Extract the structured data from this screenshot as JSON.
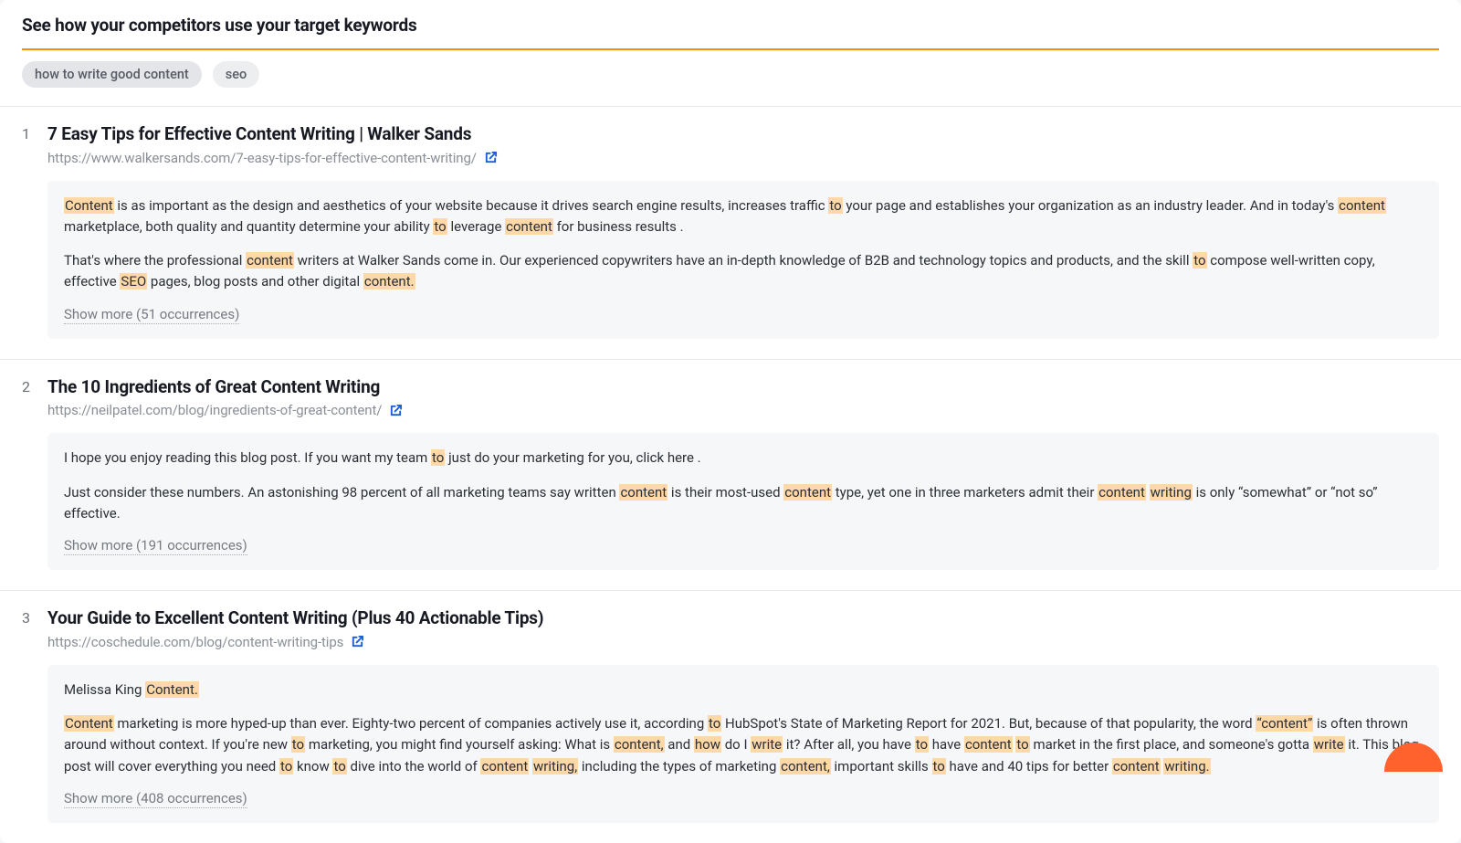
{
  "header": {
    "title": "See how your competitors use your target keywords"
  },
  "keywords": [
    "how to write good content",
    "seo"
  ],
  "results": [
    {
      "num": "1",
      "title": "7 Easy Tips for Effective Content Writing | Walker Sands",
      "url": "https://www.walkersands.com/7-easy-tips-for-effective-content-writing/",
      "paragraphs": [
        "{Content} is as important as the design and aesthetics of your website because it drives search engine results, increases traffic {to} your page and establishes your organization as an industry leader. And in today's {content} marketplace, both quality and quantity determine your ability {to} leverage {content} for business results .",
        "That's where the professional {content} writers at Walker Sands come in. Our experienced copywriters have an in-depth knowledge of B2B and technology topics and products, and the skill {to} compose well-written copy, effective {SEO} pages, blog posts and other digital {content.}"
      ],
      "show_more": "Show more (51 occurrences)"
    },
    {
      "num": "2",
      "title": "The 10 Ingredients of Great Content Writing",
      "url": "https://neilpatel.com/blog/ingredients-of-great-content/",
      "paragraphs": [
        "I hope you enjoy reading this blog post. If you want my team {to} just do your marketing for you, click here .",
        "Just consider these numbers. An astonishing 98 percent of all marketing teams say written {content} is their most-used {content} type, yet one in three marketers admit their {content} {writing} is only “somewhat” or “not so” effective."
      ],
      "show_more": "Show more (191 occurrences)"
    },
    {
      "num": "3",
      "title": "Your Guide to Excellent Content Writing (Plus 40 Actionable Tips)",
      "url": "https://coschedule.com/blog/content-writing-tips",
      "paragraphs": [
        "Melissa King {Content.}",
        "{Content} marketing is more hyped-up than ever. Eighty-two percent of companies actively use it, according {to} HubSpot's State of Marketing Report for 2021. But, because of that popularity, the word {“content”} is often thrown around without context. If you're new {to} marketing, you might find yourself asking: What is {content,} and {how} do I {write} it? After all, you have {to} have {content} {to} market in the first place, and someone's gotta {write} it. This blog post will cover everything you need {to} know {to} dive into the world of {content} {writing,} including the types of marketing {content,} important skills {to} have and 40 tips for better {content} {writing.}"
      ],
      "show_more": "Show more (408 occurrences)"
    }
  ]
}
